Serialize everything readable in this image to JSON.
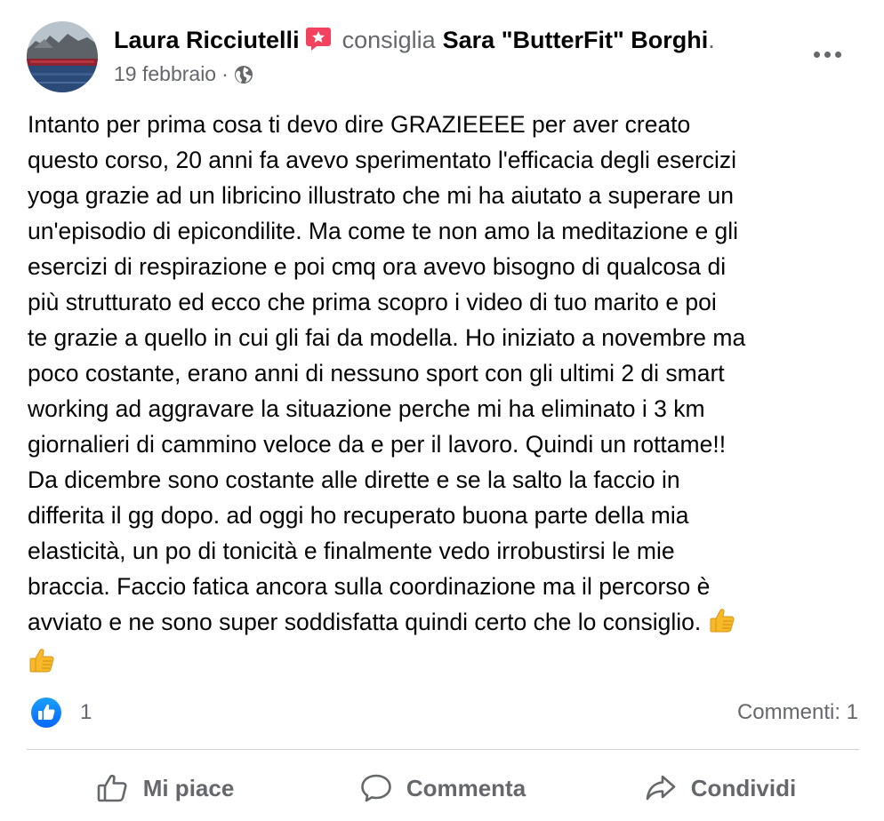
{
  "post": {
    "author": "Laura Ricciutelli",
    "verb": "consiglia",
    "page": "Sara \"ButterFit\" Borghi",
    "date": "19 febbraio",
    "meta_separator": "·",
    "text_lines": [
      "Intanto per prima cosa ti devo dire GRAZIEEEE per aver creato",
      "questo corso, 20 anni fa avevo sperimentato l'efficacia degli esercizi",
      "yoga grazie ad un libricino illustrato che mi ha aiutato a superare un",
      "un'episodio di epicondilite. Ma come te non amo la meditazione e gli",
      "esercizi di respirazione e poi cmq ora avevo bisogno di qualcosa di",
      "più strutturato ed ecco che prima scopro i video di tuo marito e poi",
      "te grazie a quello in cui gli fai da modella. Ho iniziato a novembre ma",
      "poco costante, erano anni di nessuno sport con gli ultimi 2 di smart",
      "working ad aggravare la situazione perche mi ha eliminato i 3 km",
      "giornalieri di cammino veloce da e per il lavoro. Quindi un rottame!!",
      "Da dicembre sono costante alle dirette e se la salto la faccio in",
      "differita il gg dopo. ad oggi ho recuperato buona parte della mia",
      "elasticità, un po di tonicità e finalmente vedo irrobustirsi le mie",
      "braccia. Faccio fatica ancora sulla coordinazione ma il percorso è",
      "avviato e ne sono super soddisfatta quindi certo che lo consiglio."
    ],
    "emojis": [
      "thumbs-up-emoji",
      "thumbs-up-emoji"
    ],
    "reaction_count": "1",
    "comments": "Commenti: 1"
  },
  "actions": {
    "like": "Mi piace",
    "comment": "Commenta",
    "share": "Condividi"
  },
  "icons": {
    "recommend": "recommend-badge-icon",
    "privacy": "globe-icon",
    "more": "more-options-icon",
    "like_reaction": "like-reaction-icon"
  },
  "colors": {
    "accent_blue": "#1877f2",
    "recommend_pink": "#f3425f",
    "secondary_text": "#65676b",
    "divider": "#ced0d4"
  }
}
